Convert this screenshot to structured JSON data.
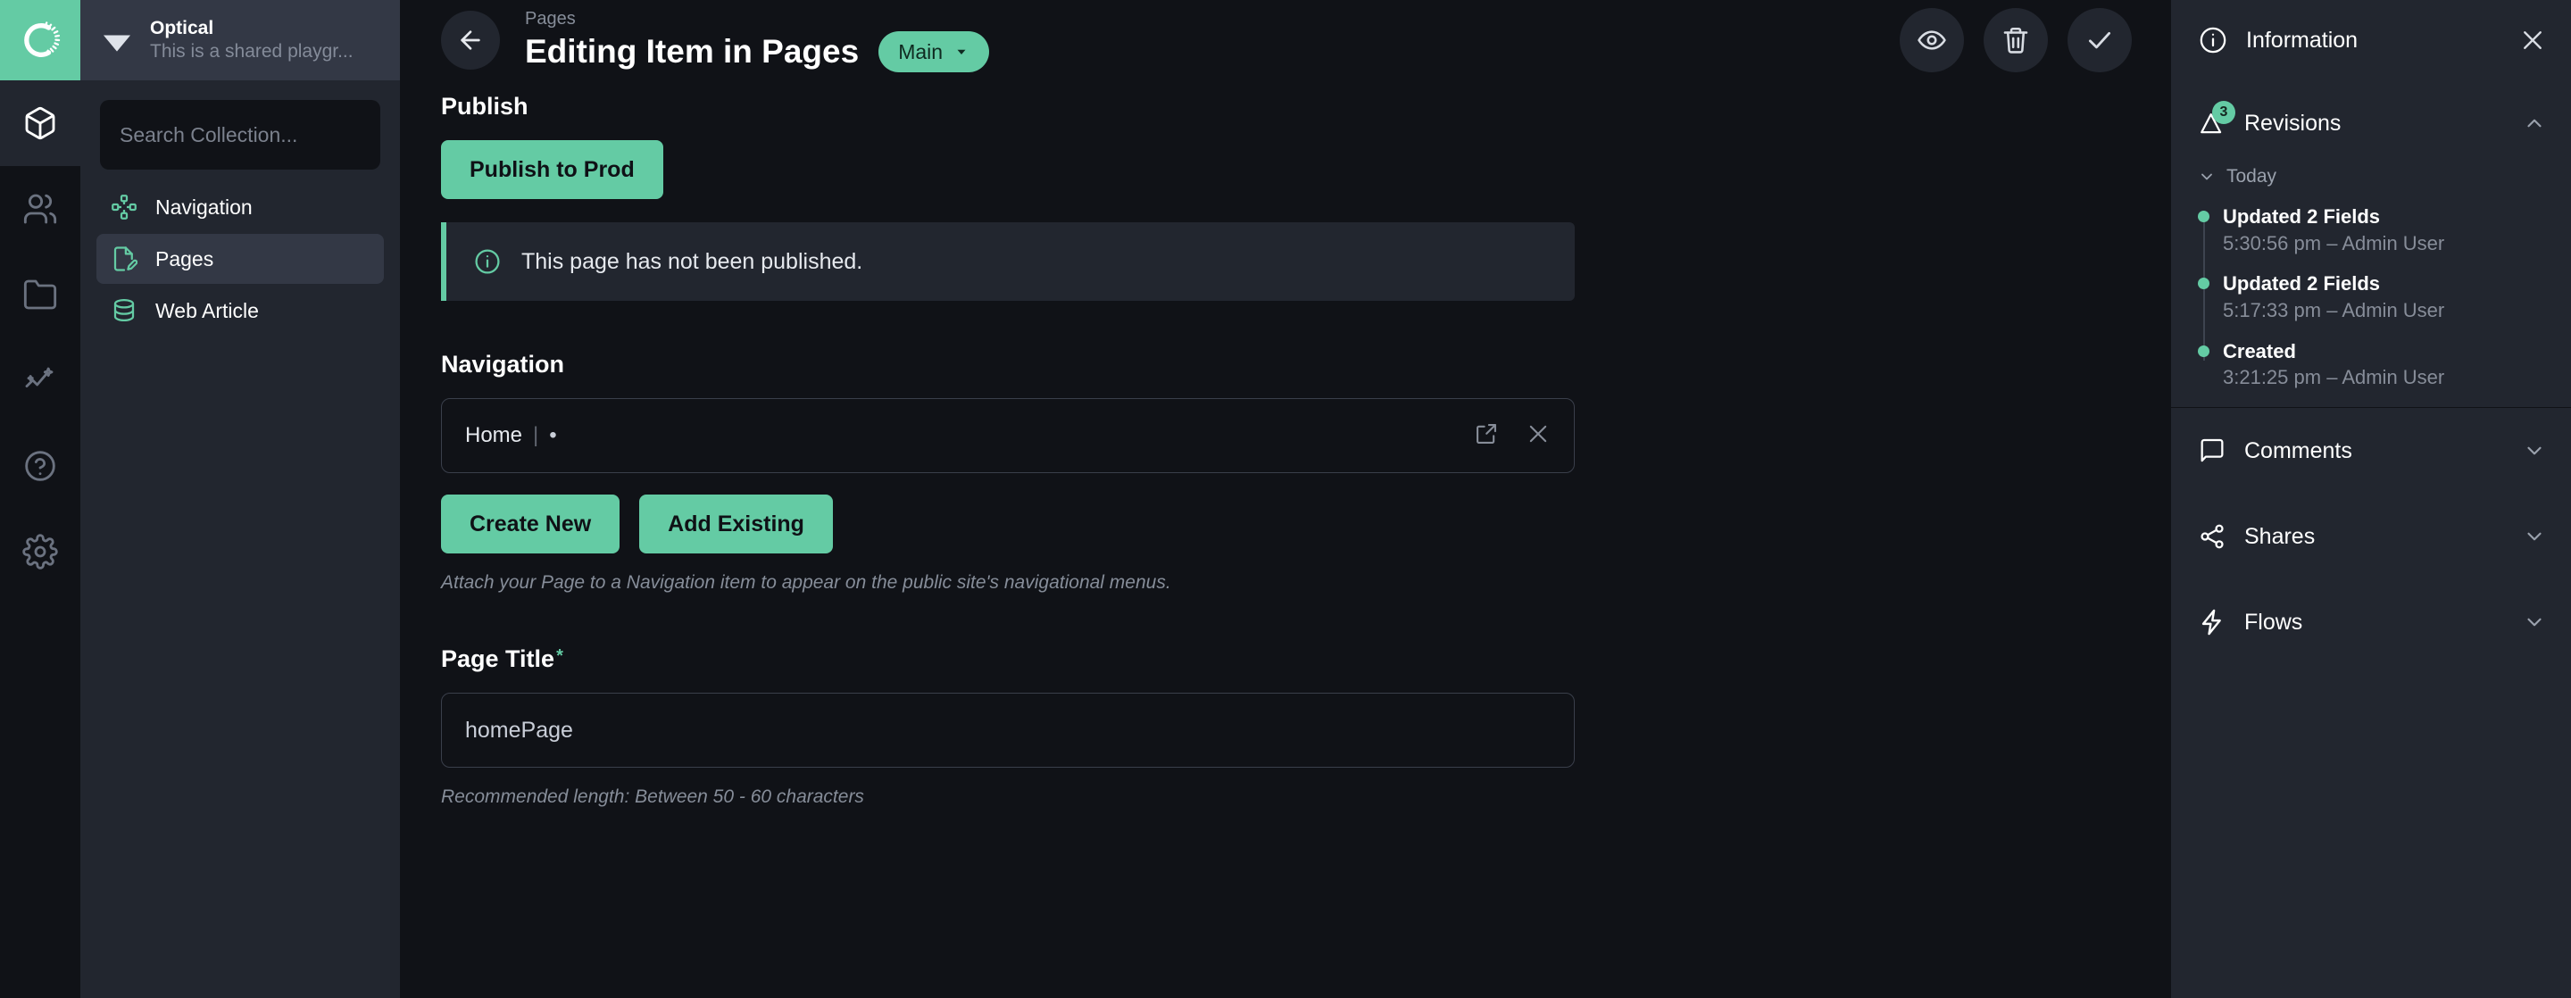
{
  "colors": {
    "accent": "#64cba4",
    "rail_bg": "#101217",
    "sidebar_bg": "#22262f",
    "main_bg": "#101217",
    "panel_bg": "#22262f",
    "workspace_bg": "#333845"
  },
  "rail": {
    "logo_name": "app-logo",
    "items": [
      {
        "name": "collections-icon",
        "label": "Collections",
        "active": true
      },
      {
        "name": "users-icon",
        "label": "Users",
        "active": false
      },
      {
        "name": "folder-icon",
        "label": "Media",
        "active": false
      },
      {
        "name": "insights-icon",
        "label": "Insights",
        "active": false
      },
      {
        "name": "help-icon",
        "label": "Help",
        "active": false
      },
      {
        "name": "gear-icon",
        "label": "Settings",
        "active": false
      }
    ]
  },
  "workspace": {
    "name": "Optical",
    "description": "This is a shared playgr...",
    "icon": "workspace-diamond-icon"
  },
  "search": {
    "placeholder": "Search Collection...",
    "value": ""
  },
  "collections": [
    {
      "label": "Navigation",
      "icon": "navigation-icon",
      "active": false
    },
    {
      "label": "Pages",
      "icon": "page-edit-icon",
      "active": true
    },
    {
      "label": "Web Article",
      "icon": "database-icon",
      "active": false
    }
  ],
  "header": {
    "back_icon": "arrow-left-icon",
    "breadcrumb": "Pages",
    "title": "Editing Item in Pages",
    "branch_label": "Main",
    "branch_caret": "chevron-down-icon",
    "actions": [
      {
        "name": "preview-button",
        "icon": "eye-icon",
        "label": "Preview"
      },
      {
        "name": "delete-button",
        "icon": "trash-icon",
        "label": "Delete"
      },
      {
        "name": "save-button",
        "icon": "check-icon",
        "label": "Save"
      }
    ]
  },
  "form": {
    "publish": {
      "label": "Publish",
      "button_label": "Publish to Prod",
      "alert_icon": "info-circle-icon",
      "alert_text": "This page has not been published."
    },
    "navigation": {
      "label": "Navigation",
      "relation_value": "Home",
      "relation_separator": "|",
      "relation_dot": "•",
      "open_icon": "external-link-icon",
      "remove_icon": "close-icon",
      "create_new_label": "Create New",
      "add_existing_label": "Add Existing",
      "help_text": "Attach your Page to a Navigation item to appear on the public site's navigational menus."
    },
    "page_title": {
      "label": "Page Title",
      "required_marker": "*",
      "value": "homePage",
      "placeholder": "",
      "help_text": "Recommended length: Between 50 - 60 characters"
    }
  },
  "info_panel": {
    "header": {
      "icon": "info-circle-icon",
      "title": "Information",
      "close_icon": "close-icon"
    },
    "revisions": {
      "icon": "revisions-icon",
      "title": "Revisions",
      "badge": "3",
      "chevron": "chevron-up-icon",
      "group_label": "Today",
      "group_chevron": "chevron-down-icon",
      "items": [
        {
          "title": "Updated 2 Fields",
          "meta": "5:30:56 pm – Admin User"
        },
        {
          "title": "Updated 2 Fields",
          "meta": "5:17:33 pm – Admin User"
        },
        {
          "title": "Created",
          "meta": "3:21:25 pm – Admin User"
        }
      ]
    },
    "sections": [
      {
        "title": "Comments",
        "icon": "comment-icon",
        "chevron": "chevron-down-icon"
      },
      {
        "title": "Shares",
        "icon": "share-icon",
        "chevron": "chevron-down-icon"
      },
      {
        "title": "Flows",
        "icon": "lightning-icon",
        "chevron": "chevron-down-icon"
      }
    ]
  }
}
